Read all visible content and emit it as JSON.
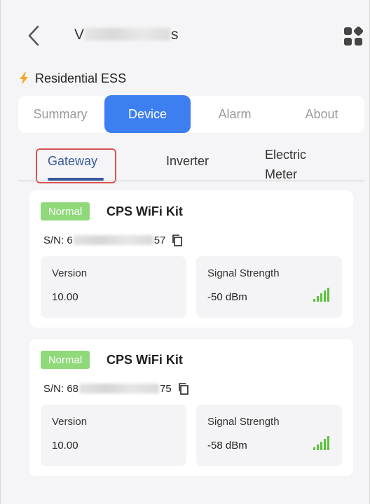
{
  "header": {
    "title_prefix": "V",
    "title_suffix": "s",
    "back_icon": "chevron-left-icon",
    "menu_icon": "grid-apps-icon"
  },
  "plant": {
    "icon": "bolt-icon",
    "label": "Residential ESS",
    "icon_color": "#f5a623"
  },
  "main_tabs": [
    {
      "label": "Summary",
      "active": false
    },
    {
      "label": "Device",
      "active": true
    },
    {
      "label": "Alarm",
      "active": false
    },
    {
      "label": "About",
      "active": false
    }
  ],
  "sub_tabs": [
    {
      "label": "Gateway",
      "active": true
    },
    {
      "label": "Inverter",
      "active": false
    },
    {
      "label": "Electric",
      "label2": "Meter",
      "active": false
    }
  ],
  "devices": [
    {
      "status": "Normal",
      "name": "CPS WiFi Kit",
      "sn_prefix": "S/N: 6",
      "sn_suffix": "57",
      "version_label": "Version",
      "version_value": "10.00",
      "signal_label": "Signal Strength",
      "signal_value": "-50 dBm"
    },
    {
      "status": "Normal",
      "name": "CPS WiFi Kit",
      "sn_prefix": "S/N: 68",
      "sn_suffix": "75",
      "version_label": "Version",
      "version_value": "10.00",
      "signal_label": "Signal Strength",
      "signal_value": "-58 dBm"
    }
  ],
  "colors": {
    "accent": "#3d7ff0",
    "status_normal": "#8fd97a",
    "signal": "#5cc23d",
    "highlight_box": "#d9534f"
  }
}
